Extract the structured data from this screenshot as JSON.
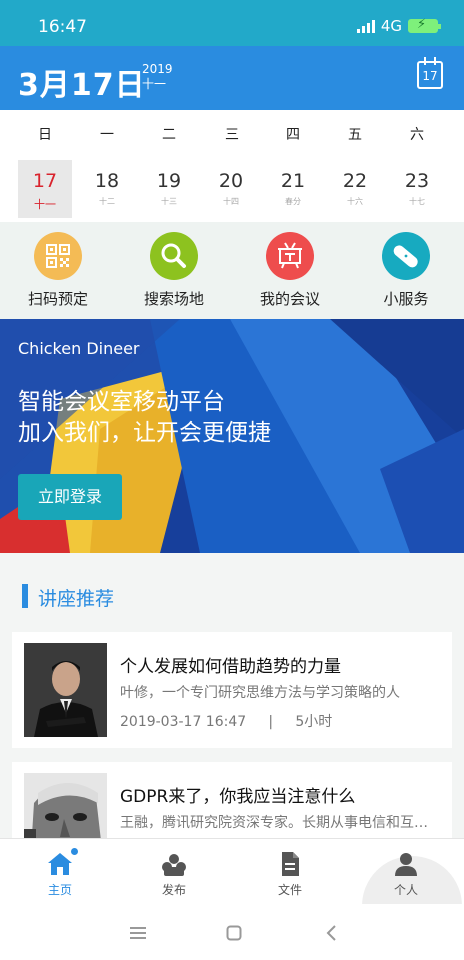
{
  "status": {
    "time": "16:47",
    "network": "4G"
  },
  "header": {
    "date": "3月17日",
    "year": "2019",
    "lunar": "十一",
    "calendar_icon_day": "17"
  },
  "week": {
    "weekdays": [
      "日",
      "一",
      "二",
      "三",
      "四",
      "五",
      "六"
    ],
    "days": [
      {
        "num": "17",
        "lunar": "十一",
        "selected": true
      },
      {
        "num": "18",
        "lunar": "十二"
      },
      {
        "num": "19",
        "lunar": "十三"
      },
      {
        "num": "20",
        "lunar": "十四"
      },
      {
        "num": "21",
        "lunar": "春分"
      },
      {
        "num": "22",
        "lunar": "十六"
      },
      {
        "num": "23",
        "lunar": "十七"
      }
    ]
  },
  "quick": [
    {
      "label": "扫码预定",
      "icon": "qr-code-icon",
      "color": "#f4bb55"
    },
    {
      "label": "搜索场地",
      "icon": "search-icon",
      "color": "#8dc21f"
    },
    {
      "label": "我的会议",
      "icon": "meeting-icon",
      "color": "#ee4d4d"
    },
    {
      "label": "小服务",
      "icon": "bandage-icon",
      "color": "#17aac0"
    }
  ],
  "banner": {
    "title": "Chicken Dineer",
    "line1": "智能会议室移动平台",
    "line2": "加入我们，让开会更便捷",
    "button": "立即登录"
  },
  "section": {
    "title": "讲座推荐"
  },
  "lectures": [
    {
      "title": "个人发展如何借助趋势的力量",
      "desc": "叶修，一个专门研究思维方法与学习策略的人",
      "time": "2019-03-17 16:47",
      "duration": "5小时"
    },
    {
      "title": "GDPR来了，你我应当注意什么",
      "desc": "王融，腾讯研究院资深专家。长期从事电信和互联网政策研究"
    }
  ],
  "tabs": [
    {
      "label": "主页",
      "icon": "home-icon",
      "active": true
    },
    {
      "label": "发布",
      "icon": "publish-icon"
    },
    {
      "label": "文件",
      "icon": "file-icon"
    },
    {
      "label": "个人",
      "icon": "person-icon"
    }
  ],
  "colors": {
    "primary": "#2a8ce0",
    "statusbar": "#22a9c9",
    "selected_day": "#d9232d"
  }
}
